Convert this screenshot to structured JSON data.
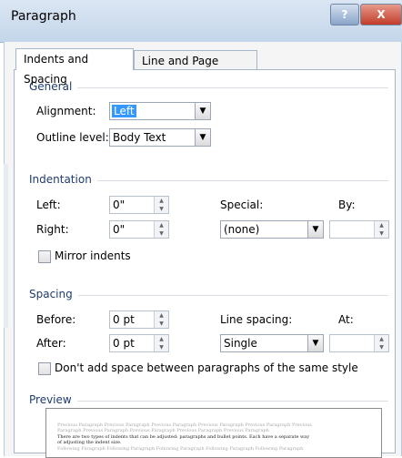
{
  "window": {
    "title": "Paragraph",
    "help_glyph": "?",
    "close_glyph": "X"
  },
  "tabs": [
    {
      "label": "Indents and Spacing",
      "active": true
    },
    {
      "label": "Line and Page Breaks",
      "active": false
    }
  ],
  "general": {
    "heading": "General",
    "alignment_label": "Alignment:",
    "alignment_value": "Left",
    "outline_label": "Outline level:",
    "outline_value": "Body Text"
  },
  "indentation": {
    "heading": "Indentation",
    "left_label": "Left:",
    "left_value": "0\"",
    "right_label": "Right:",
    "right_value": "0\"",
    "special_label": "Special:",
    "special_value": "(none)",
    "by_label": "By:",
    "by_value": "",
    "mirror_label": "Mirror indents",
    "mirror_checked": false
  },
  "spacing": {
    "heading": "Spacing",
    "before_label": "Before:",
    "before_value": "0 pt",
    "after_label": "After:",
    "after_value": "0 pt",
    "line_spacing_label": "Line spacing:",
    "line_spacing_value": "Single",
    "at_label": "At:",
    "at_value": "",
    "dont_add_label": "Don't add space between paragraphs of the same style",
    "dont_add_checked": false
  },
  "preview": {
    "heading": "Preview",
    "prev_line1": "Previous Paragraph Previous Paragraph Previous Paragraph Previous Paragraph Previous Paragraph Previous",
    "prev_line2": "Paragraph Previous Paragraph Previous Paragraph Previous Paragraph Previous Paragraph",
    "main_line1": "There are two types of indents that can be adjusted: paragraphs and bullet points. Each have a separate way",
    "main_line2": "of adjusting the indent size.",
    "next_line1": "Following Paragraph Following Paragraph Following Paragraph Following Paragraph Following Paragraph"
  },
  "icons": {
    "dropdown": "▼",
    "spin_up": "▲",
    "spin_down": "▼"
  },
  "colors": {
    "accent": "#3399ff",
    "close_button": "#c23c2a",
    "group_heading": "#1f3b6e"
  }
}
